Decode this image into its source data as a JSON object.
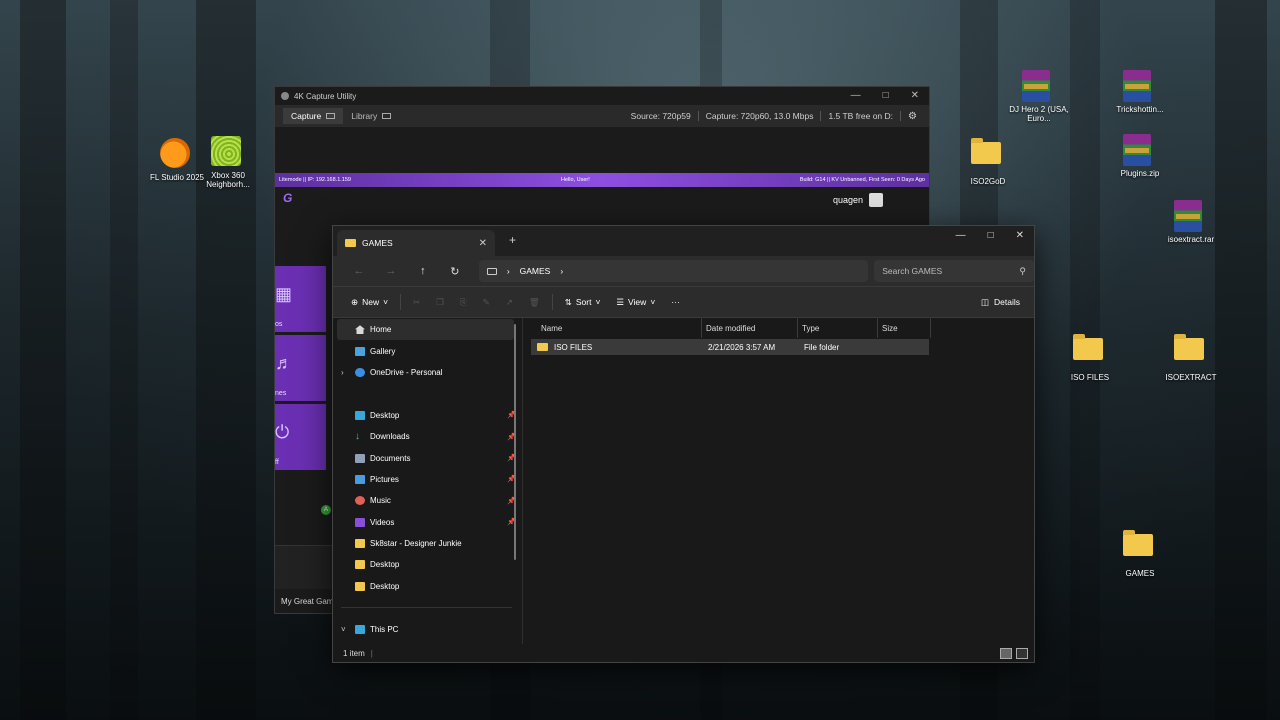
{
  "desktop": {
    "icons": [
      {
        "label": "FL Studio 2025"
      },
      {
        "label": "Xbox 360 Neighborh..."
      },
      {
        "label": "DJ Hero 2 (USA, Euro..."
      },
      {
        "label": "Trickshottin..."
      },
      {
        "label": "ISO2GoD"
      },
      {
        "label": "Plugins.zip"
      },
      {
        "label": "isoextract.rar"
      },
      {
        "label": "ISO FILES"
      },
      {
        "label": "ISOEXTRACT"
      },
      {
        "label": "GAMES"
      }
    ]
  },
  "capture": {
    "title": "4K Capture Utility",
    "tabs": [
      "Capture",
      "Library"
    ],
    "source": "Source: 720p59",
    "capture_info": "Capture: 720p60, 13.0 Mbps",
    "free_space": "1.5 TB free on D:",
    "banner_left": "Litemode || IP: 192.168.1.159",
    "banner_center": "Hello, User!",
    "banner_right": "Build: G14 || KV Unbanned, First Seen: 0 Days Ago",
    "username": "quagen",
    "tile_labels": [
      "os",
      "nes",
      "ff"
    ],
    "a_button": "A",
    "game_line": "My Great Gam"
  },
  "explorer": {
    "tab_title": "GAMES",
    "address": [
      "GAMES"
    ],
    "search_placeholder": "Search GAMES",
    "commands": {
      "new": "New",
      "sort": "Sort",
      "view": "View",
      "more": "···",
      "details": "Details"
    },
    "nav": {
      "home": "Home",
      "gallery": "Gallery",
      "onedrive": "OneDrive - Personal",
      "desktop": "Desktop",
      "downloads": "Downloads",
      "documents": "Documents",
      "pictures": "Pictures",
      "music": "Music",
      "videos": "Videos",
      "folder1": "Sk8star - Designer Junkie",
      "folder2": "Desktop",
      "folder3": "Desktop",
      "thispc": "This PC"
    },
    "columns": {
      "name": "Name",
      "date": "Date modified",
      "type": "Type",
      "size": "Size"
    },
    "files": [
      {
        "name": "ISO FILES",
        "date": "2/21/2026 3:57 AM",
        "type": "File folder",
        "size": ""
      }
    ],
    "status": "1 item"
  },
  "colors": {
    "accent_purple": "#6a2fb3",
    "folder": "#f2c94c"
  }
}
